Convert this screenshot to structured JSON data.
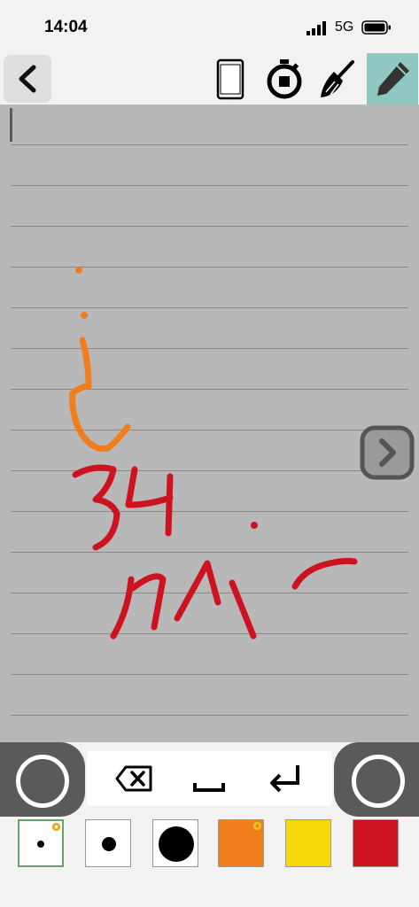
{
  "status_bar": {
    "time": "14:04",
    "network": "5G"
  },
  "toolbar": {
    "back_icon": "chevron-left-icon",
    "tools": [
      "phone-frame-icon",
      "stopwatch-icon",
      "broom-icon",
      "pencil-icon"
    ],
    "active_tool": "pencil",
    "active_color": "#8ec8c0"
  },
  "canvas": {
    "background": "#b8b8b8",
    "line_color": "#8a8a8a",
    "cursor_glyph": "'"
  },
  "keypad": {
    "keys": [
      "backspace-icon",
      "space-icon",
      "return-icon"
    ]
  },
  "palette": {
    "selected_index": 0,
    "swatches": [
      {
        "kind": "small-dot",
        "color": "#000000"
      },
      {
        "kind": "medium-dot",
        "color": "#000000"
      },
      {
        "kind": "large-dot",
        "color": "#000000"
      },
      {
        "kind": "fill",
        "color": "#f07e1c"
      },
      {
        "kind": "fill",
        "color": "#f5d90a"
      },
      {
        "kind": "fill",
        "color": "#cc1421"
      }
    ]
  }
}
